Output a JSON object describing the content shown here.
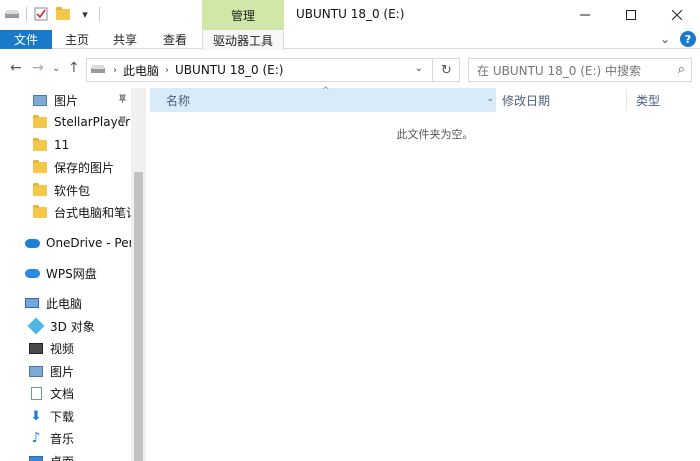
{
  "window": {
    "title": "UBUNTU 18_0 (E:)",
    "contextual_group": "管理",
    "controls": [
      "minimize",
      "maximize",
      "close"
    ]
  },
  "quick_access_toolbar": {
    "icons": [
      "drive-icon",
      "checkbox-icon",
      "folder-icon",
      "dropdown-icon"
    ],
    "dropdown_glyph": "▾"
  },
  "ribbon": {
    "tabs": [
      {
        "label": "文件",
        "active": true
      },
      {
        "label": "主页"
      },
      {
        "label": "共享"
      },
      {
        "label": "查看"
      },
      {
        "label": "驱动器工具"
      }
    ],
    "collapse_glyph": "⌄",
    "help_glyph": "?"
  },
  "navigation": {
    "back": "←",
    "forward": "→",
    "recent": "⌄",
    "up": "↑",
    "address": {
      "crumbs": [
        "此电脑",
        "UBUNTU 18_0 (E:)"
      ],
      "separator": "›",
      "dropdown": "⌄",
      "refresh": "↻"
    },
    "search_placeholder": "在 UBUNTU 18_0 (E:) 中搜索",
    "search_icon": "⌕"
  },
  "nav_pane": {
    "items": [
      {
        "label": "图片",
        "icon": "picture-icon",
        "pinned": true
      },
      {
        "label": "StellarPlayer",
        "icon": "folder-icon",
        "pinned": true
      },
      {
        "label": "11",
        "icon": "folder-icon"
      },
      {
        "label": "保存的图片",
        "icon": "folder-icon"
      },
      {
        "label": "软件包",
        "icon": "folder-icon"
      },
      {
        "label": "台式电脑和笔记",
        "icon": "folder-icon"
      },
      {
        "label": "OneDrive - Perso",
        "icon": "onedrive-icon"
      },
      {
        "label": "WPS网盘",
        "icon": "cloud-icon"
      },
      {
        "label": "此电脑",
        "icon": "this-pc-icon"
      },
      {
        "label": "3D 对象",
        "icon": "3d-objects-icon"
      },
      {
        "label": "视频",
        "icon": "video-icon"
      },
      {
        "label": "图片",
        "icon": "picture-icon"
      },
      {
        "label": "文档",
        "icon": "document-icon"
      },
      {
        "label": "下载",
        "icon": "download-icon"
      },
      {
        "label": "音乐",
        "icon": "music-icon"
      },
      {
        "label": "桌面",
        "icon": "desktop-icon"
      }
    ],
    "pin_glyph": "📌",
    "download_glyph": "⬇",
    "music_glyph": "♪"
  },
  "content": {
    "columns": [
      {
        "label": "名称",
        "sorted": true
      },
      {
        "label": "修改日期"
      },
      {
        "label": "类型"
      }
    ],
    "sort_glyph": "^",
    "column_dropdown": "⌄",
    "empty_message": "此文件夹为空。"
  },
  "colors": {
    "accent": "#1979ca",
    "manage_tab": "#cfe8a9",
    "header_highlight": "#d9ebf9"
  }
}
